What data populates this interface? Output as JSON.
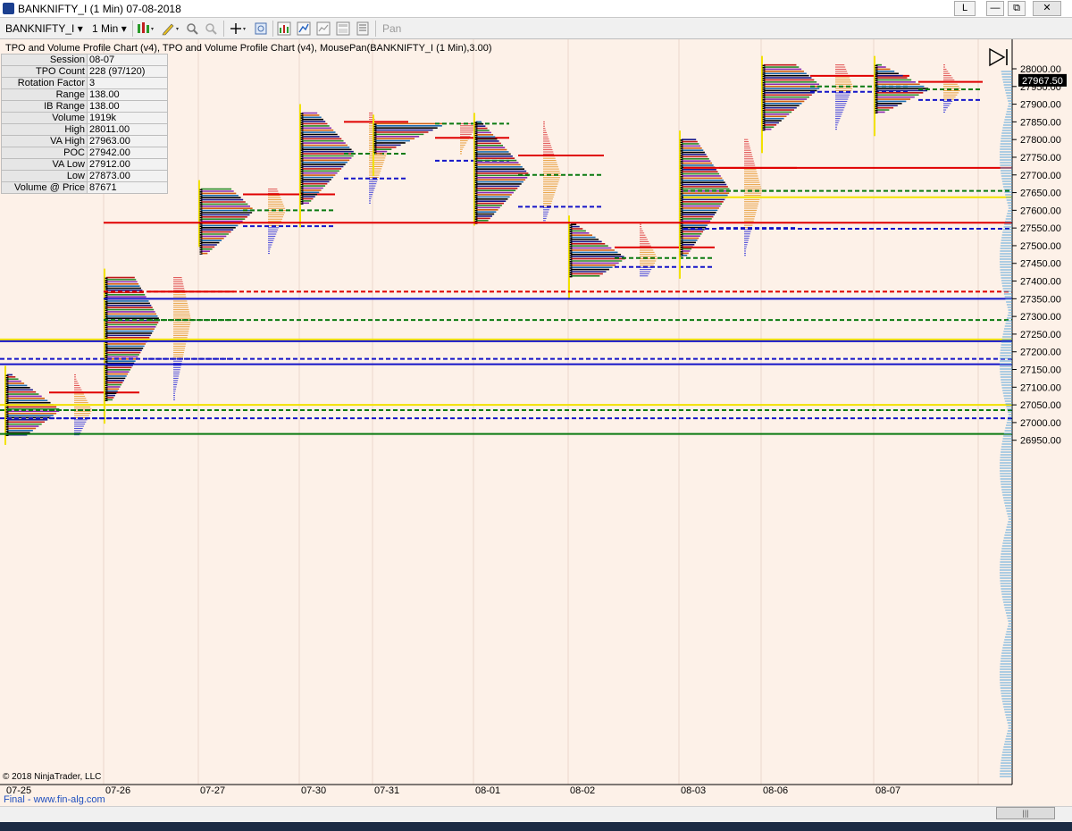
{
  "window": {
    "title": "BANKNIFTY_I (1 Min)  07-08-2018",
    "buttons": [
      "L",
      "—",
      "⧉",
      "✕"
    ]
  },
  "toolbar": {
    "instrument": "BANKNIFTY_I",
    "interval": "1 Min",
    "pan_label": "Pan"
  },
  "indicator_label": "TPO and Volume Profile Chart (v4),  TPO and Volume Profile Chart (v4), MousePan(BANKNIFTY_I (1 Min),3.00)",
  "info_table": [
    {
      "label": "Session",
      "value": "08-07"
    },
    {
      "label": "TPO Count",
      "value": "228 (97/120)"
    },
    {
      "label": "Rotation Factor",
      "value": "3"
    },
    {
      "label": "Range",
      "value": "138.00"
    },
    {
      "label": "IB Range",
      "value": "138.00"
    },
    {
      "label": "Volume",
      "value": "1919k"
    },
    {
      "label": "High",
      "value": "28011.00"
    },
    {
      "label": "VA High",
      "value": "27963.00"
    },
    {
      "label": "POC",
      "value": "27942.00"
    },
    {
      "label": "VA Low",
      "value": "27912.00"
    },
    {
      "label": "Low",
      "value": "27873.00"
    },
    {
      "label": "Volume @ Price",
      "value": "87671"
    }
  ],
  "copyright": "© 2018 NinjaTrader, LLC",
  "footer_text": "Final - www.fin-alg.com",
  "colors": {
    "background": "#fdf1e8",
    "vah": "#e00000",
    "poc": "#0a7a10",
    "val": "#1414c8",
    "ib": "#f2e200",
    "volume": "#e8a040",
    "current_price_box": "#000000"
  },
  "chart_data": {
    "type": "heatmap",
    "symbol": "BANKNIFTY_I",
    "interval": "1 Min",
    "current_price": "27967.50",
    "y_ticks": [
      "28000.00",
      "27950.00",
      "27900.00",
      "27850.00",
      "27800.00",
      "27750.00",
      "27700.00",
      "27650.00",
      "27600.00",
      "27550.00",
      "27500.00",
      "27450.00",
      "27400.00",
      "27350.00",
      "27300.00",
      "27250.00",
      "27200.00",
      "27150.00",
      "27100.00",
      "27050.00",
      "27000.00",
      "26950.00"
    ],
    "ylim": [
      26940,
      28030
    ],
    "sessions": [
      {
        "date": "07-25",
        "high": 27135,
        "low": 26962,
        "poc": 27035,
        "vah": 27085,
        "val": 27012,
        "ib_high": 27135,
        "ib_low": 27000
      },
      {
        "date": "07-26",
        "high": 27410,
        "low": 27060,
        "poc": 27290,
        "vah": 27370,
        "val": 27180,
        "ib_high": 27410,
        "ib_low": 27060
      },
      {
        "date": "07-27",
        "high": 27660,
        "low": 27475,
        "poc": 27600,
        "vah": 27645,
        "val": 27555,
        "ib_high": 27660,
        "ib_low": 27560
      },
      {
        "date": "07-30",
        "high": 27875,
        "low": 27615,
        "poc": 27760,
        "vah": 27850,
        "val": 27690,
        "ib_high": 27875,
        "ib_low": 27615
      },
      {
        "date": "07-31",
        "high": 27845,
        "low": 27760,
        "poc": 27845,
        "vah": 27805,
        "val": 27740,
        "ib_high": 27845,
        "ib_low": 27760
      },
      {
        "date": "08-01",
        "high": 27850,
        "low": 27560,
        "poc": 27700,
        "vah": 27755,
        "val": 27610,
        "ib_high": 27850,
        "ib_low": 27620
      },
      {
        "date": "08-02",
        "high": 27560,
        "low": 27410,
        "poc": 27465,
        "vah": 27495,
        "val": 27440,
        "ib_high": 27560,
        "ib_low": 27410
      },
      {
        "date": "08-03",
        "high": 27800,
        "low": 27470,
        "poc": 27655,
        "vah": 27720,
        "val": 27550,
        "ib_high": 27800,
        "ib_low": 27470
      },
      {
        "date": "08-06",
        "high": 28011,
        "low": 27825,
        "poc": 27950,
        "vah": 27980,
        "val": 27935,
        "ib_high": 28011,
        "ib_low": 27825
      },
      {
        "date": "08-07",
        "high": 28011,
        "low": 27873,
        "poc": 27942,
        "vah": 27963,
        "val": 27912,
        "ib_high": 28011,
        "ib_low": 27873
      }
    ],
    "x_labels": [
      "07-25",
      "07-26",
      "07-27",
      "07-30",
      "07-31",
      "08-01",
      "08-02",
      "08-03",
      "08-06",
      "08-07"
    ]
  }
}
